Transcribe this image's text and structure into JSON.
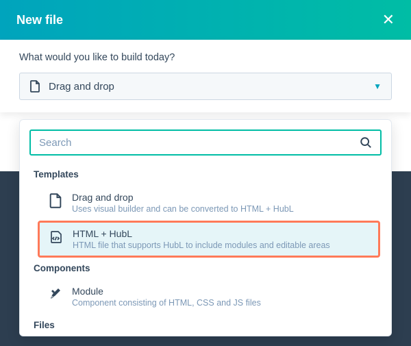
{
  "header": {
    "title": "New file"
  },
  "prompt": "What would you like to build today?",
  "select": {
    "selected_label": "Drag and drop"
  },
  "search": {
    "placeholder": "Search"
  },
  "groups": {
    "templates": {
      "label": "Templates",
      "items": [
        {
          "title": "Drag and drop",
          "desc": "Uses visual builder and can be converted to HTML + HubL"
        },
        {
          "title": "HTML + HubL",
          "desc": "HTML file that supports HubL to include modules and editable areas"
        }
      ]
    },
    "components": {
      "label": "Components",
      "items": [
        {
          "title": "Module",
          "desc": "Component consisting of HTML, CSS and JS files"
        }
      ]
    },
    "files": {
      "label": "Files"
    }
  }
}
